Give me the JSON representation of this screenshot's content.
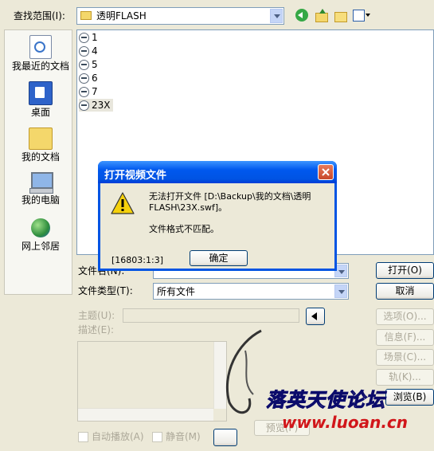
{
  "lookin": {
    "label": "查找范围(I):",
    "value": "透明FLASH"
  },
  "places": [
    {
      "id": "recent",
      "label": "我最近的文档",
      "icon": "recent-documents-icon"
    },
    {
      "id": "desktop",
      "label": "桌面",
      "icon": "desktop-icon"
    },
    {
      "id": "mydocs",
      "label": "我的文档",
      "icon": "my-documents-icon"
    },
    {
      "id": "mypc",
      "label": "我的电脑",
      "icon": "my-computer-icon"
    },
    {
      "id": "network",
      "label": "网上邻居",
      "icon": "network-places-icon"
    }
  ],
  "files": [
    "1",
    "4",
    "5",
    "6",
    "7",
    "23X"
  ],
  "filename": {
    "label": "文件名(N):",
    "value": ""
  },
  "filetype": {
    "label": "文件类型(T):",
    "value": "所有文件"
  },
  "buttons": {
    "open": "打开(O)",
    "cancel": "取消",
    "options": "选项(O)...",
    "info": "信息(F)...",
    "scene": "场景(C)...",
    "track": "轨(K)...",
    "browse": "浏览(B)",
    "preview": "预览(P)"
  },
  "meta": {
    "subject_label": "主题(U):",
    "subject_value": "",
    "desc_label": "描述(E):"
  },
  "checkboxes": {
    "autoplay": "自动播放(A)",
    "mute": "静音(M)"
  },
  "dialog": {
    "title": "打开视频文件",
    "message_line1": "无法打开文件 [D:\\Backup\\我的文档\\透明",
    "message_line2": "FLASH\\23X.swf]。",
    "message_line3": "文件格式不匹配。",
    "code": "[16803:1:3]",
    "ok": "确定"
  },
  "watermark": {
    "text1": "落英天使论坛",
    "text2": "www.luoan.cn"
  }
}
